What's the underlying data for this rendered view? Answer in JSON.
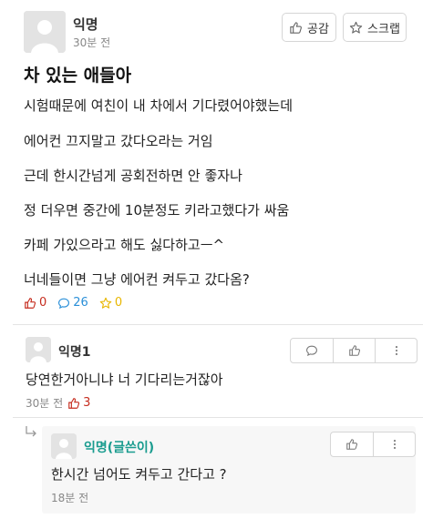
{
  "post": {
    "author": "익명",
    "time": "30분 전",
    "like_button": "공감",
    "scrap_button": "스크랩",
    "title": "차 있는 애들아",
    "body": [
      "시험때문에 여친이 내 차에서 기다렸어야했는데",
      "에어컨 끄지말고 갔다오라는 거임",
      "근데 한시간넘게 공회전하면 안 좋자나",
      "정 더우면 중간에 10분정도 키라고했다가 싸움",
      "카페 가있으라고 해도 싫다하고ㅡ^",
      "너네들이면 그냥 에어컨 켜두고 갔다옴?"
    ],
    "stats": {
      "likes": "0",
      "comments": "26",
      "scraps": "0"
    }
  },
  "comments": [
    {
      "author": "익명1",
      "text": "당연한거아니냐 너 기다리는거잖아",
      "time": "30분 전",
      "likes": "3"
    }
  ],
  "reply": {
    "author": "익명(글쓴이)",
    "text": "한시간 넘어도 켜두고 간다고 ?",
    "time": "18분 전"
  },
  "colors": {
    "like": "#c62d1f",
    "comment": "#2a8fd8",
    "scrap": "#e8b600",
    "writer": "#1a9c8f"
  }
}
